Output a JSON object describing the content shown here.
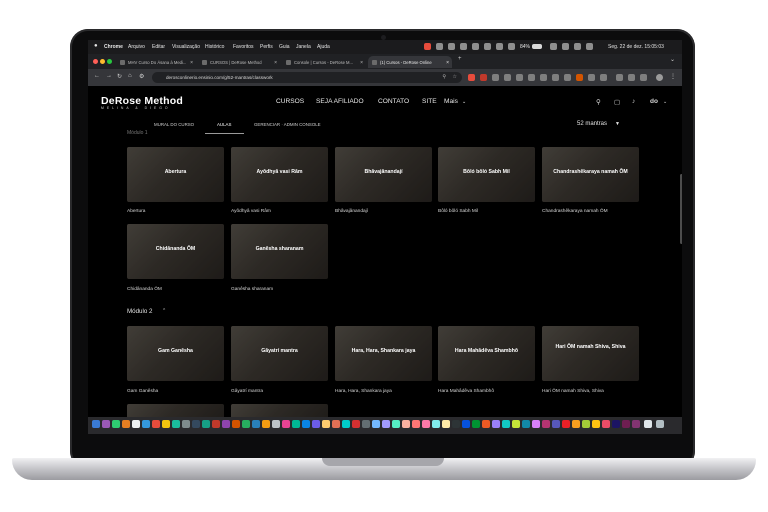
{
  "menubar": {
    "app": "Chrome",
    "items": [
      "Arquivo",
      "Editar",
      "Visualização",
      "Histórico",
      "Favoritos",
      "Perfis",
      "Guia",
      "Janela",
      "Ajuda"
    ],
    "battery": "84%",
    "clock": "Seg. 22 de dez.  15:05:03"
  },
  "browser": {
    "tabs": [
      {
        "title": "MHV Curso Do Ásana à Medi..."
      },
      {
        "title": "CURSOS | DeRose Method"
      },
      {
        "title": "Console | Cursos - DeRose M..."
      },
      {
        "title": "(1) Cursos - DeRose Online"
      }
    ],
    "url": "derosconlinerio.ensinio.com/g/52-mantras/classwork"
  },
  "site": {
    "logo": "DeRose Method",
    "logo_sub": "MELINA & DIEGO",
    "nav": [
      "CURSOS",
      "SEJA AFILIADO",
      "CONTATO",
      "SITE",
      "Mais"
    ],
    "user": "do",
    "subtabs": [
      "MURAL DO CURSO",
      "AULAS",
      "GERENCIAR · ADMIN CONSOLE"
    ],
    "count": "52 mantras",
    "module1_partial": "Módulo 1",
    "module2": "Módulo 2"
  },
  "grid1": [
    {
      "overlay": "Abertura",
      "caption": "Abertura"
    },
    {
      "overlay": "Ayôdhyâ vasi Râm",
      "caption": "Ayôdhyâ vasi Râm"
    },
    {
      "overlay": "Bhâvajânandají",
      "caption": "Bhâvajânandají"
    },
    {
      "overlay": "Bôló bôló Sabh Mil",
      "caption": "Bôló bôló Sabh Mil"
    },
    {
      "overlay": "Chandrashêkaraya namah ÔM",
      "caption": "Chandrashêkaraya namah ÔM"
    },
    {
      "overlay": "Chidânanda ÔM",
      "caption": "Chidânanda ÔM"
    },
    {
      "overlay": "Ganêsha sharanam",
      "caption": "Ganêsha sharanam"
    }
  ],
  "grid2": [
    {
      "overlay": "Gam Ganêsha",
      "caption": "Gam Ganêsha"
    },
    {
      "overlay": "Gâyatrí mantra",
      "caption": "Gâyatrí mantra"
    },
    {
      "overlay": "Hara, Hara, Shankara jaya",
      "caption": "Hara, Hara, Shankara jaya"
    },
    {
      "overlay": "Hara Mahâdêva Shambhô",
      "caption": "Hara Mahâdêva Shambhô"
    },
    {
      "overlay": "Hari ÔM namah Shiva, Shiva",
      "caption": "Hari ÔM namah Shiva, Shiva"
    }
  ]
}
